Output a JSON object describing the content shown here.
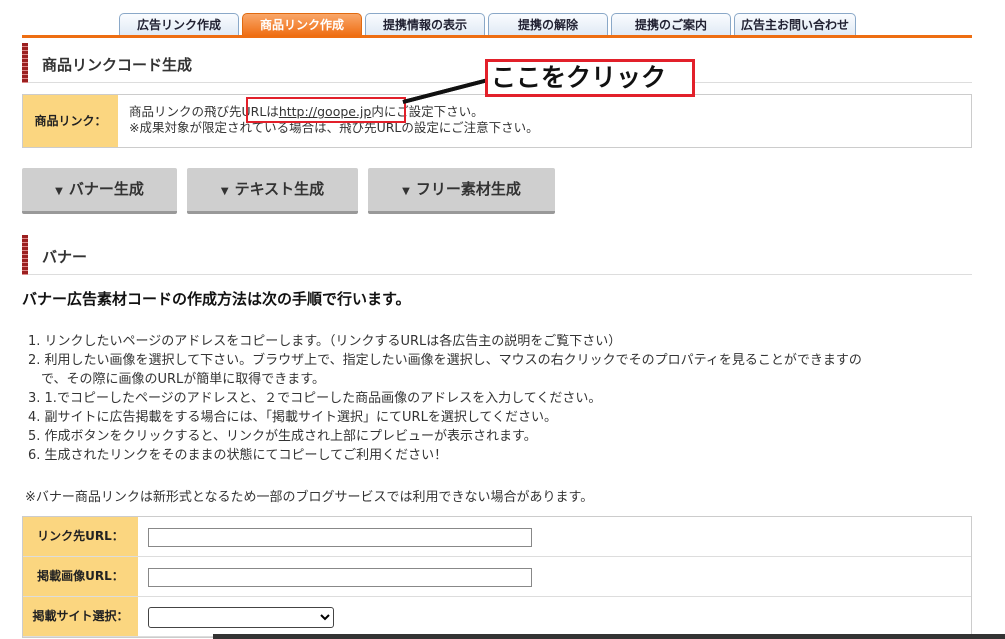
{
  "tabs": [
    {
      "label": "広告リンク作成"
    },
    {
      "label": "商品リンク作成"
    },
    {
      "label": "提携情報の表示"
    },
    {
      "label": "提携の解除"
    },
    {
      "label": "提携のご案内"
    },
    {
      "label": "広告主お問い合わせ"
    }
  ],
  "section1": {
    "title": "商品リンクコード生成"
  },
  "product_link": {
    "label": "商品リンク：",
    "line1_prefix": "商品リンクの飛び先URLは",
    "url": "http://goope.jp",
    "line1_suffix": "内にご設定下さい。",
    "line2": "※成果対象が限定されている場合は、飛び先URLの設定にご注意下さい。"
  },
  "callout": {
    "text": "ここをクリック"
  },
  "buttons": {
    "banner": "バナー生成",
    "text": "テキスト生成",
    "free": "フリー素材生成"
  },
  "section2": {
    "title": "バナー"
  },
  "steps_heading": "バナー広告素材コードの作成方法は次の手順で行います。",
  "steps": [
    "1. リンクしたいページのアドレスをコピーします。（リンクするURLは各広告主の説明をご覧下さい）",
    "2. 利用したい画像を選択して下さい。ブラウザ上で、指定したい画像を選択し、マウスの右クリックでそのプロパティを見ることができますの",
    "　で、その際に画像のURLが簡単に取得できます。",
    "3. 1.でコピーしたページのアドレスと、２でコピーした商品画像のアドレスを入力してください。",
    "4. 副サイトに広告掲載をする場合には、「掲載サイト選択」にてURLを選択してください。",
    "5. 作成ボタンをクリックすると、リンクが生成され上部にプレビューが表示されます。",
    "6. 生成されたリンクをそのままの状態にてコピーしてご利用ください！"
  ],
  "note": "※バナー商品リンクは新形式となるため一部のブログサービスでは利用できない場合があります。",
  "form": {
    "link_url_label": "リンク先URL：",
    "link_url_value": "",
    "image_url_label": "掲載画像URL：",
    "image_url_value": "",
    "site_label": "掲載サイト選択：",
    "site_value": ""
  }
}
